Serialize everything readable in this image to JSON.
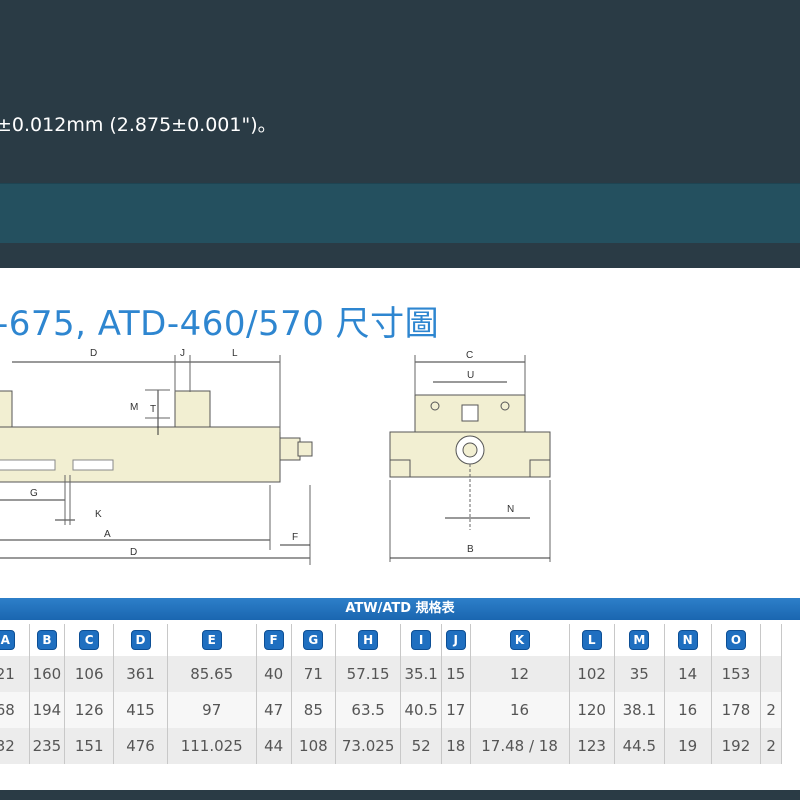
{
  "top": {
    "spec_text": "±0.012mm (2.875±0.001\")。"
  },
  "title": "-675, ATD-460/570 尺寸圖",
  "drawing_labels": {
    "D_top": "D",
    "J": "J",
    "L": "L",
    "M": "M",
    "T": "T",
    "G": "G",
    "K": "K",
    "A": "A",
    "D_bottom": "D",
    "F": "F",
    "C": "C",
    "U": "U",
    "N": "N",
    "B": "B"
  },
  "table": {
    "header": "ATW/ATD 規格表",
    "columns": [
      "A",
      "B",
      "C",
      "D",
      "E",
      "F",
      "G",
      "H",
      "I",
      "J",
      "K",
      "L",
      "M",
      "N",
      "O"
    ],
    "rows": [
      [
        "21",
        "160",
        "106",
        "361",
        "85.65",
        "40",
        "71",
        "57.15",
        "35.1",
        "15",
        "12",
        "102",
        "35",
        "14",
        "153"
      ],
      [
        "68",
        "194",
        "126",
        "415",
        "97",
        "47",
        "85",
        "63.5",
        "40.5",
        "17",
        "16",
        "120",
        "38.1",
        "16",
        "178"
      ],
      [
        "32",
        "235",
        "151",
        "476",
        "111.025",
        "44",
        "108",
        "73.025",
        "52",
        "18",
        "17.48 / 18",
        "123",
        "44.5",
        "19",
        "192"
      ]
    ],
    "trailing_partial": [
      "",
      "2",
      "2"
    ]
  },
  "colors": {
    "accent_blue": "#2e86d0",
    "vise_body": "#f2efd2",
    "header_bg": "#2a3b45"
  }
}
